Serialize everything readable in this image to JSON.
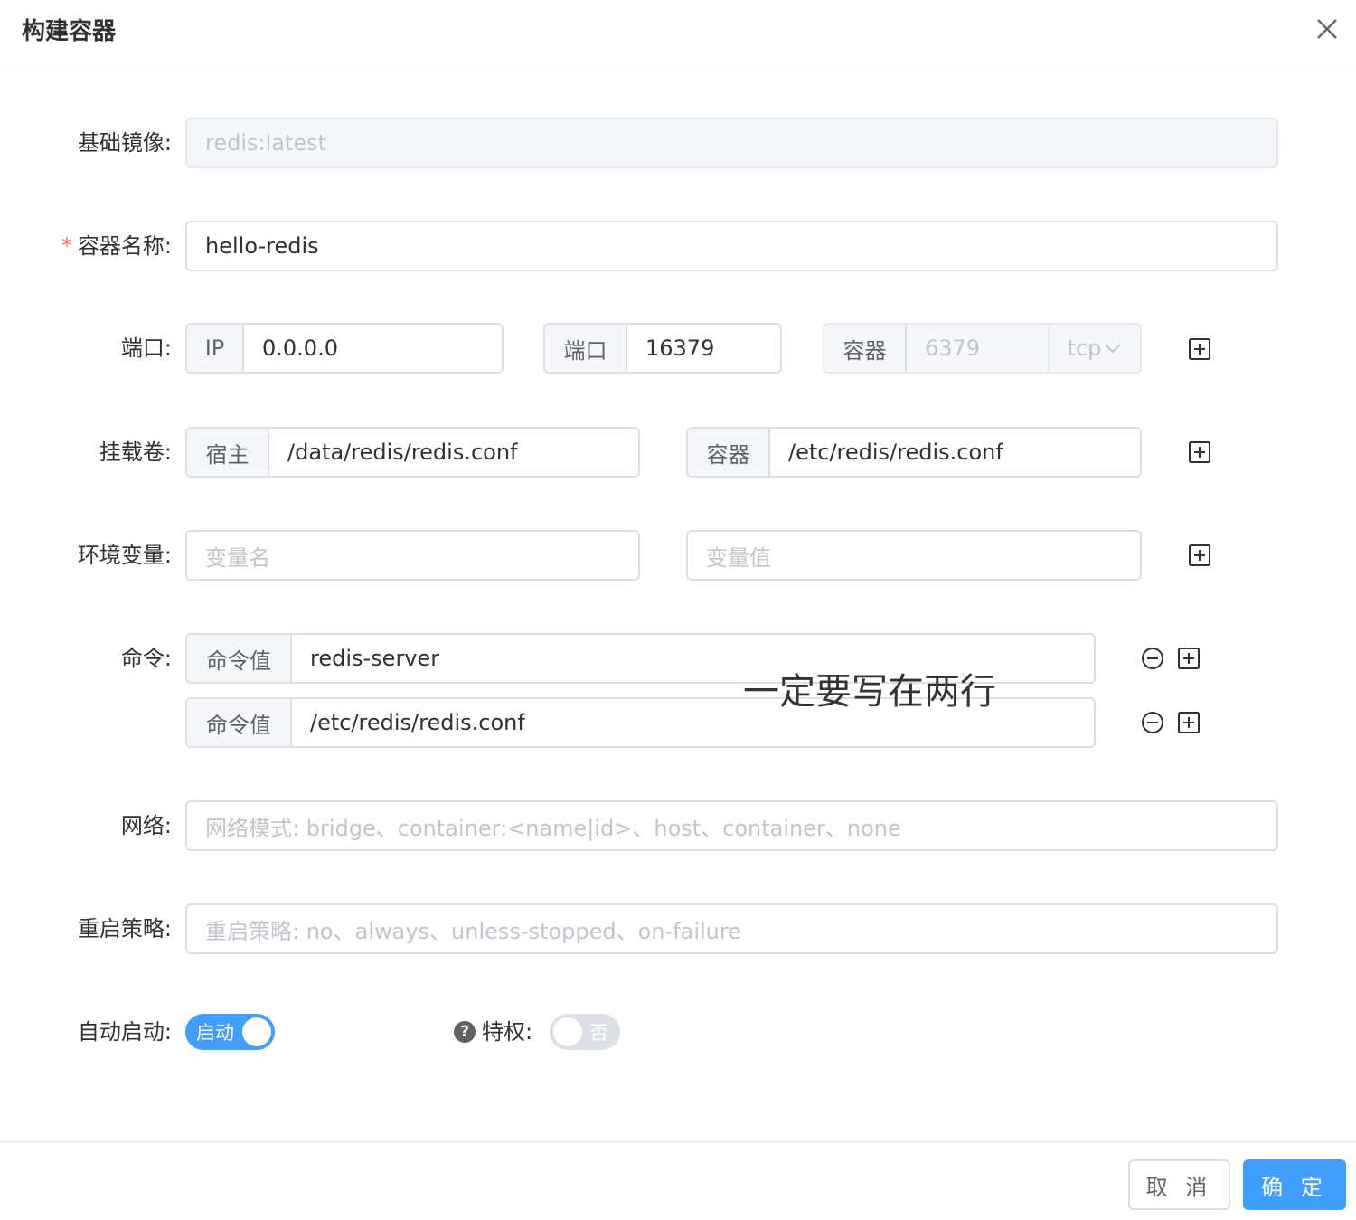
{
  "dialog": {
    "title": "构建容器"
  },
  "form": {
    "base_image": {
      "label": "基础镜像:",
      "value": "redis:latest"
    },
    "container_name": {
      "required_mark": "*",
      "label": "容器名称:",
      "value": "hello-redis"
    },
    "port": {
      "label": "端口:",
      "ip_prefix": "IP",
      "ip_value": "0.0.0.0",
      "host_prefix": "端口",
      "host_value": "16379",
      "container_prefix": "容器",
      "container_value": "6379",
      "protocol": "tcp"
    },
    "volume": {
      "label": "挂载卷:",
      "host_prefix": "宿主",
      "host_value": "/data/redis/redis.conf",
      "container_prefix": "容器",
      "container_value": "/etc/redis/redis.conf"
    },
    "env": {
      "label": "环境变量:",
      "name_placeholder": "变量名",
      "value_placeholder": "变量值"
    },
    "command": {
      "label": "命令:",
      "items": [
        {
          "prefix": "命令值",
          "value": "redis-server"
        },
        {
          "prefix": "命令值",
          "value": "/etc/redis/redis.conf"
        }
      ]
    },
    "network": {
      "label": "网络:",
      "placeholder": "网络模式: bridge、container:<name|id>、host、container、none"
    },
    "restart": {
      "label": "重启策略:",
      "placeholder": "重启策略: no、always、unless-stopped、on-failure"
    },
    "autostart": {
      "label": "自动启动:",
      "switch_text": "启动",
      "on": true
    },
    "privileged": {
      "help": "?",
      "label": "特权:",
      "switch_text": "否",
      "on": false
    }
  },
  "annotation": "一定要写在两行",
  "footer": {
    "cancel": "取 消",
    "ok": "确 定"
  },
  "colors": {
    "primary": "#409eff",
    "required": "#f56c6c",
    "border": "#dcdfe6",
    "placeholder": "#c0c4cc"
  },
  "icons": [
    "close-icon",
    "plus-square-icon",
    "minus-circle-icon",
    "chevron-down-icon",
    "question-circle-icon"
  ]
}
